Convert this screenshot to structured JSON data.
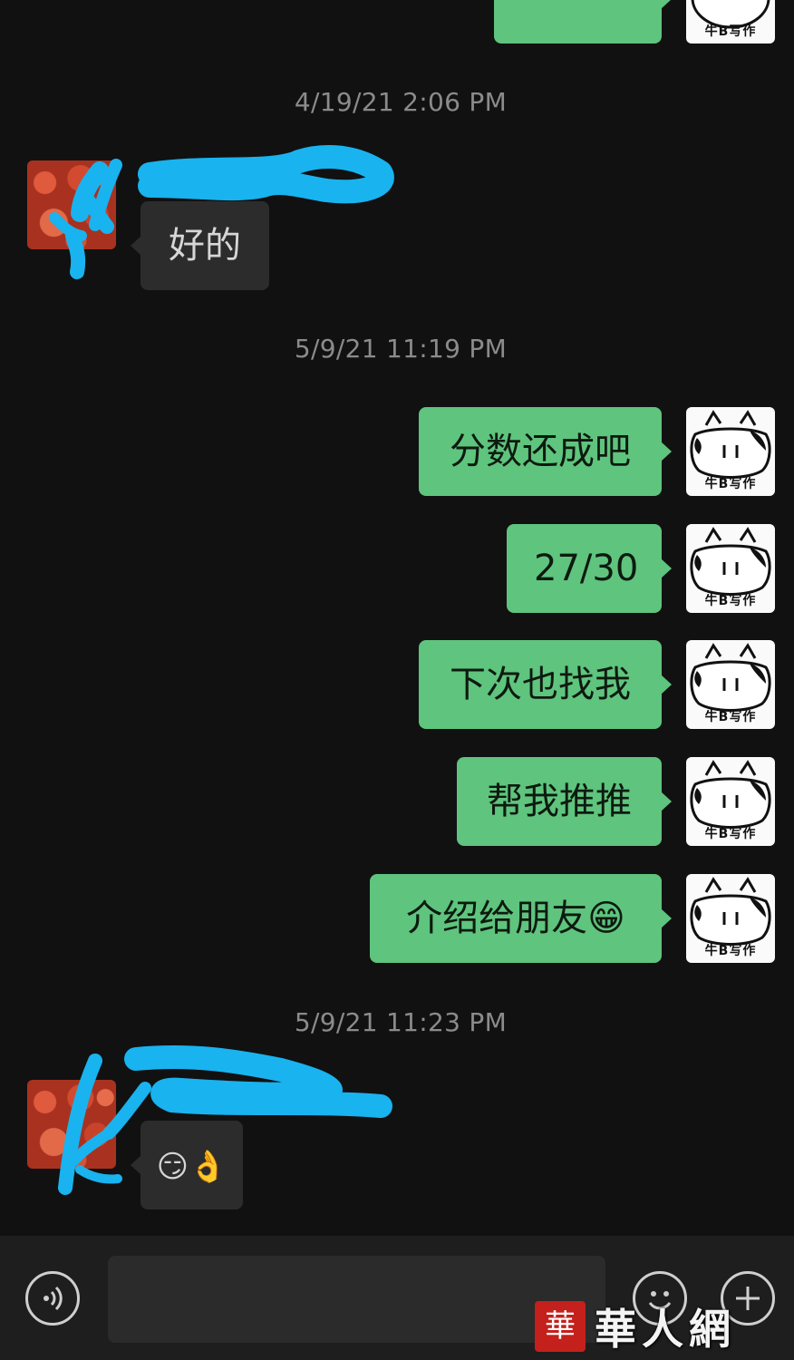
{
  "avatar_label_self": "牛B写作",
  "timestamps": [
    "4/19/21 2:06 PM",
    "5/9/21 11:19 PM",
    "5/9/21 11:23 PM"
  ],
  "messages": {
    "partial_top_text": "好的",
    "reply_1": "好的",
    "sent_1": "分数还成吧",
    "sent_2": "27/30",
    "sent_3": "下次也找我",
    "sent_4": "帮我推推",
    "sent_5": "介绍给朋友",
    "sent_5_emoji": "😁",
    "reply_2_emoji": "😏👌"
  },
  "colors": {
    "background": "#111111",
    "bubble_out": "#5fc47d",
    "bubble_in": "#2c2c2c",
    "redaction": "#19b3ef"
  },
  "input_bar": {
    "voice_icon": "voice-icon",
    "emoji_icon": "emoji-icon",
    "plus_icon": "plus-icon"
  },
  "watermark": {
    "seal": "華",
    "text": "華人網"
  }
}
